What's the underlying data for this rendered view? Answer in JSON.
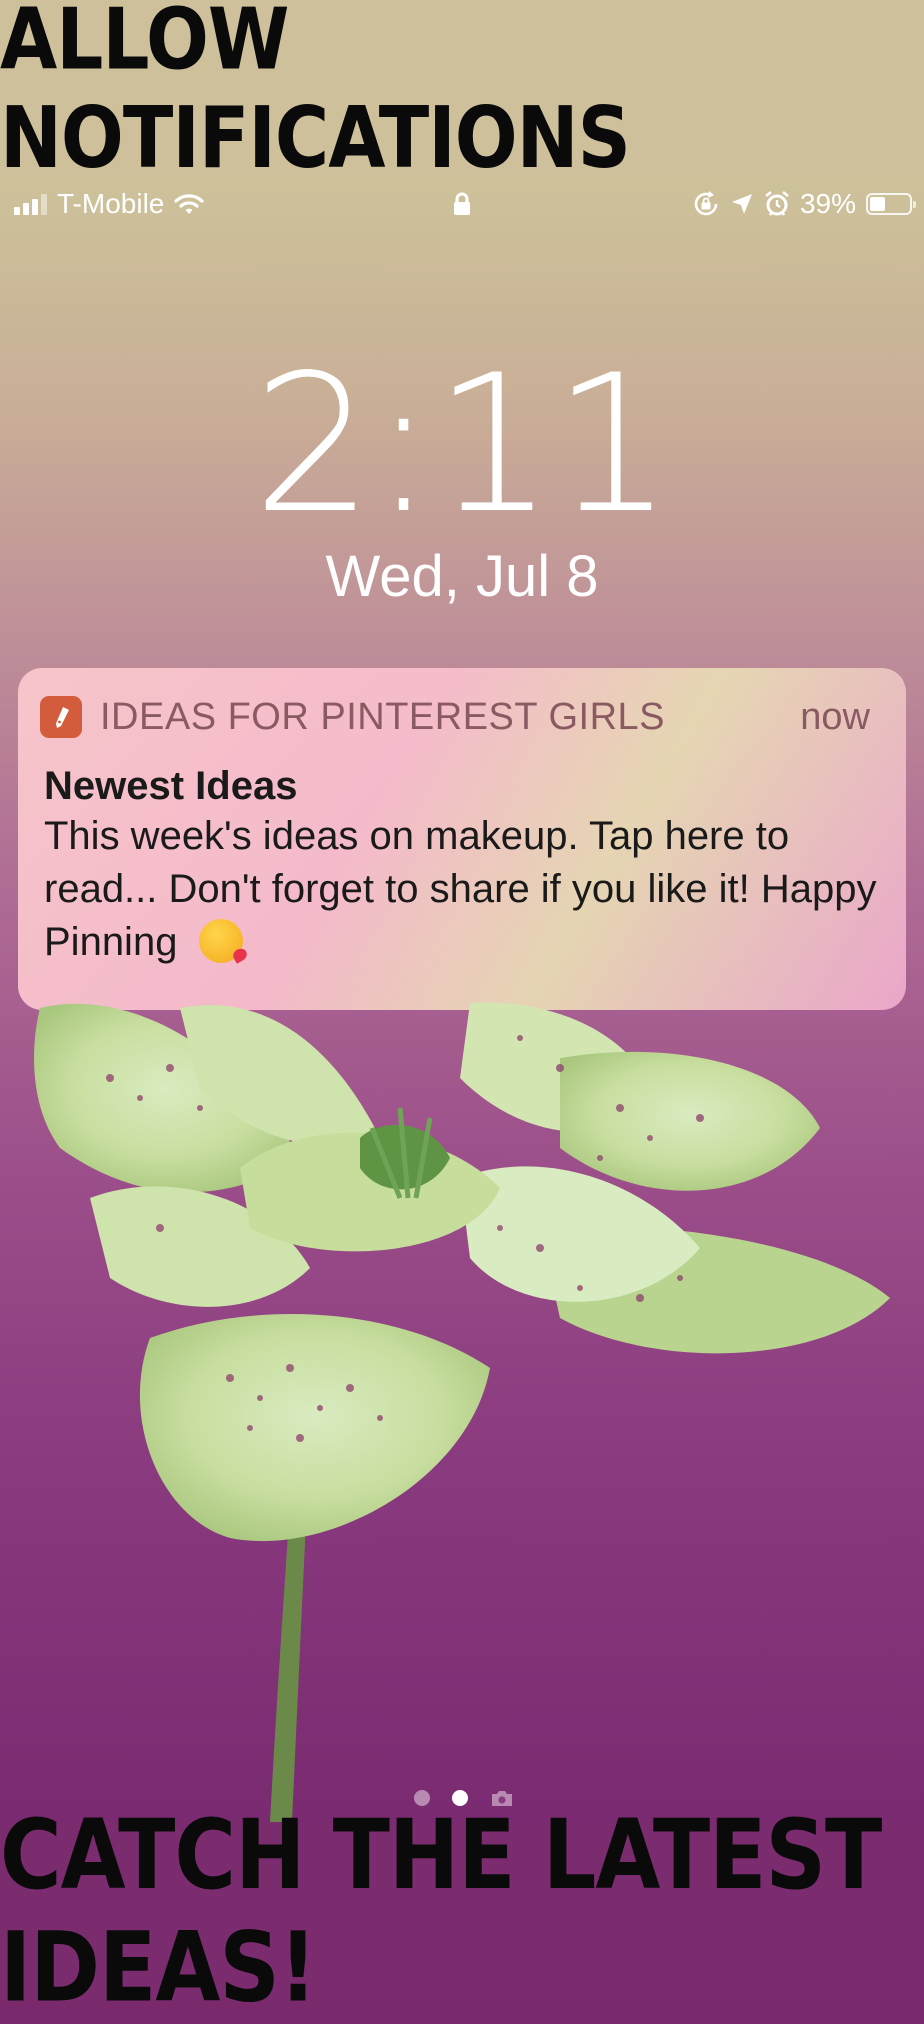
{
  "banners": {
    "top": "ALLOW NOTIFICATIONS",
    "bottom": "CATCH THE LATEST IDEAS!"
  },
  "status_bar": {
    "carrier": "T-Mobile",
    "battery": "39%",
    "battery_level": 0.39,
    "icons": [
      "signal-icon",
      "wifi-icon",
      "lock-icon",
      "rotation-lock-icon",
      "location-icon",
      "alarm-icon",
      "battery-icon"
    ]
  },
  "lock_screen": {
    "time": "2:11",
    "date": "Wed, Jul 8"
  },
  "notification": {
    "app_name": "IDEAS FOR PINTEREST GIRLS",
    "time": "now",
    "title": "Newest Ideas",
    "body": "This week's ideas on makeup. Tap here to read... Don't forget to share if you like it! Happy Pinning",
    "icon": "pen-icon",
    "emoji": "kissing-face-emoji"
  },
  "page_indicator": {
    "pages": 3,
    "active_index": 1
  },
  "colors": {
    "top_banner": "#cdc09b",
    "bottom_banner": "#7a2c6e",
    "app_icon": "#d25c3c"
  }
}
